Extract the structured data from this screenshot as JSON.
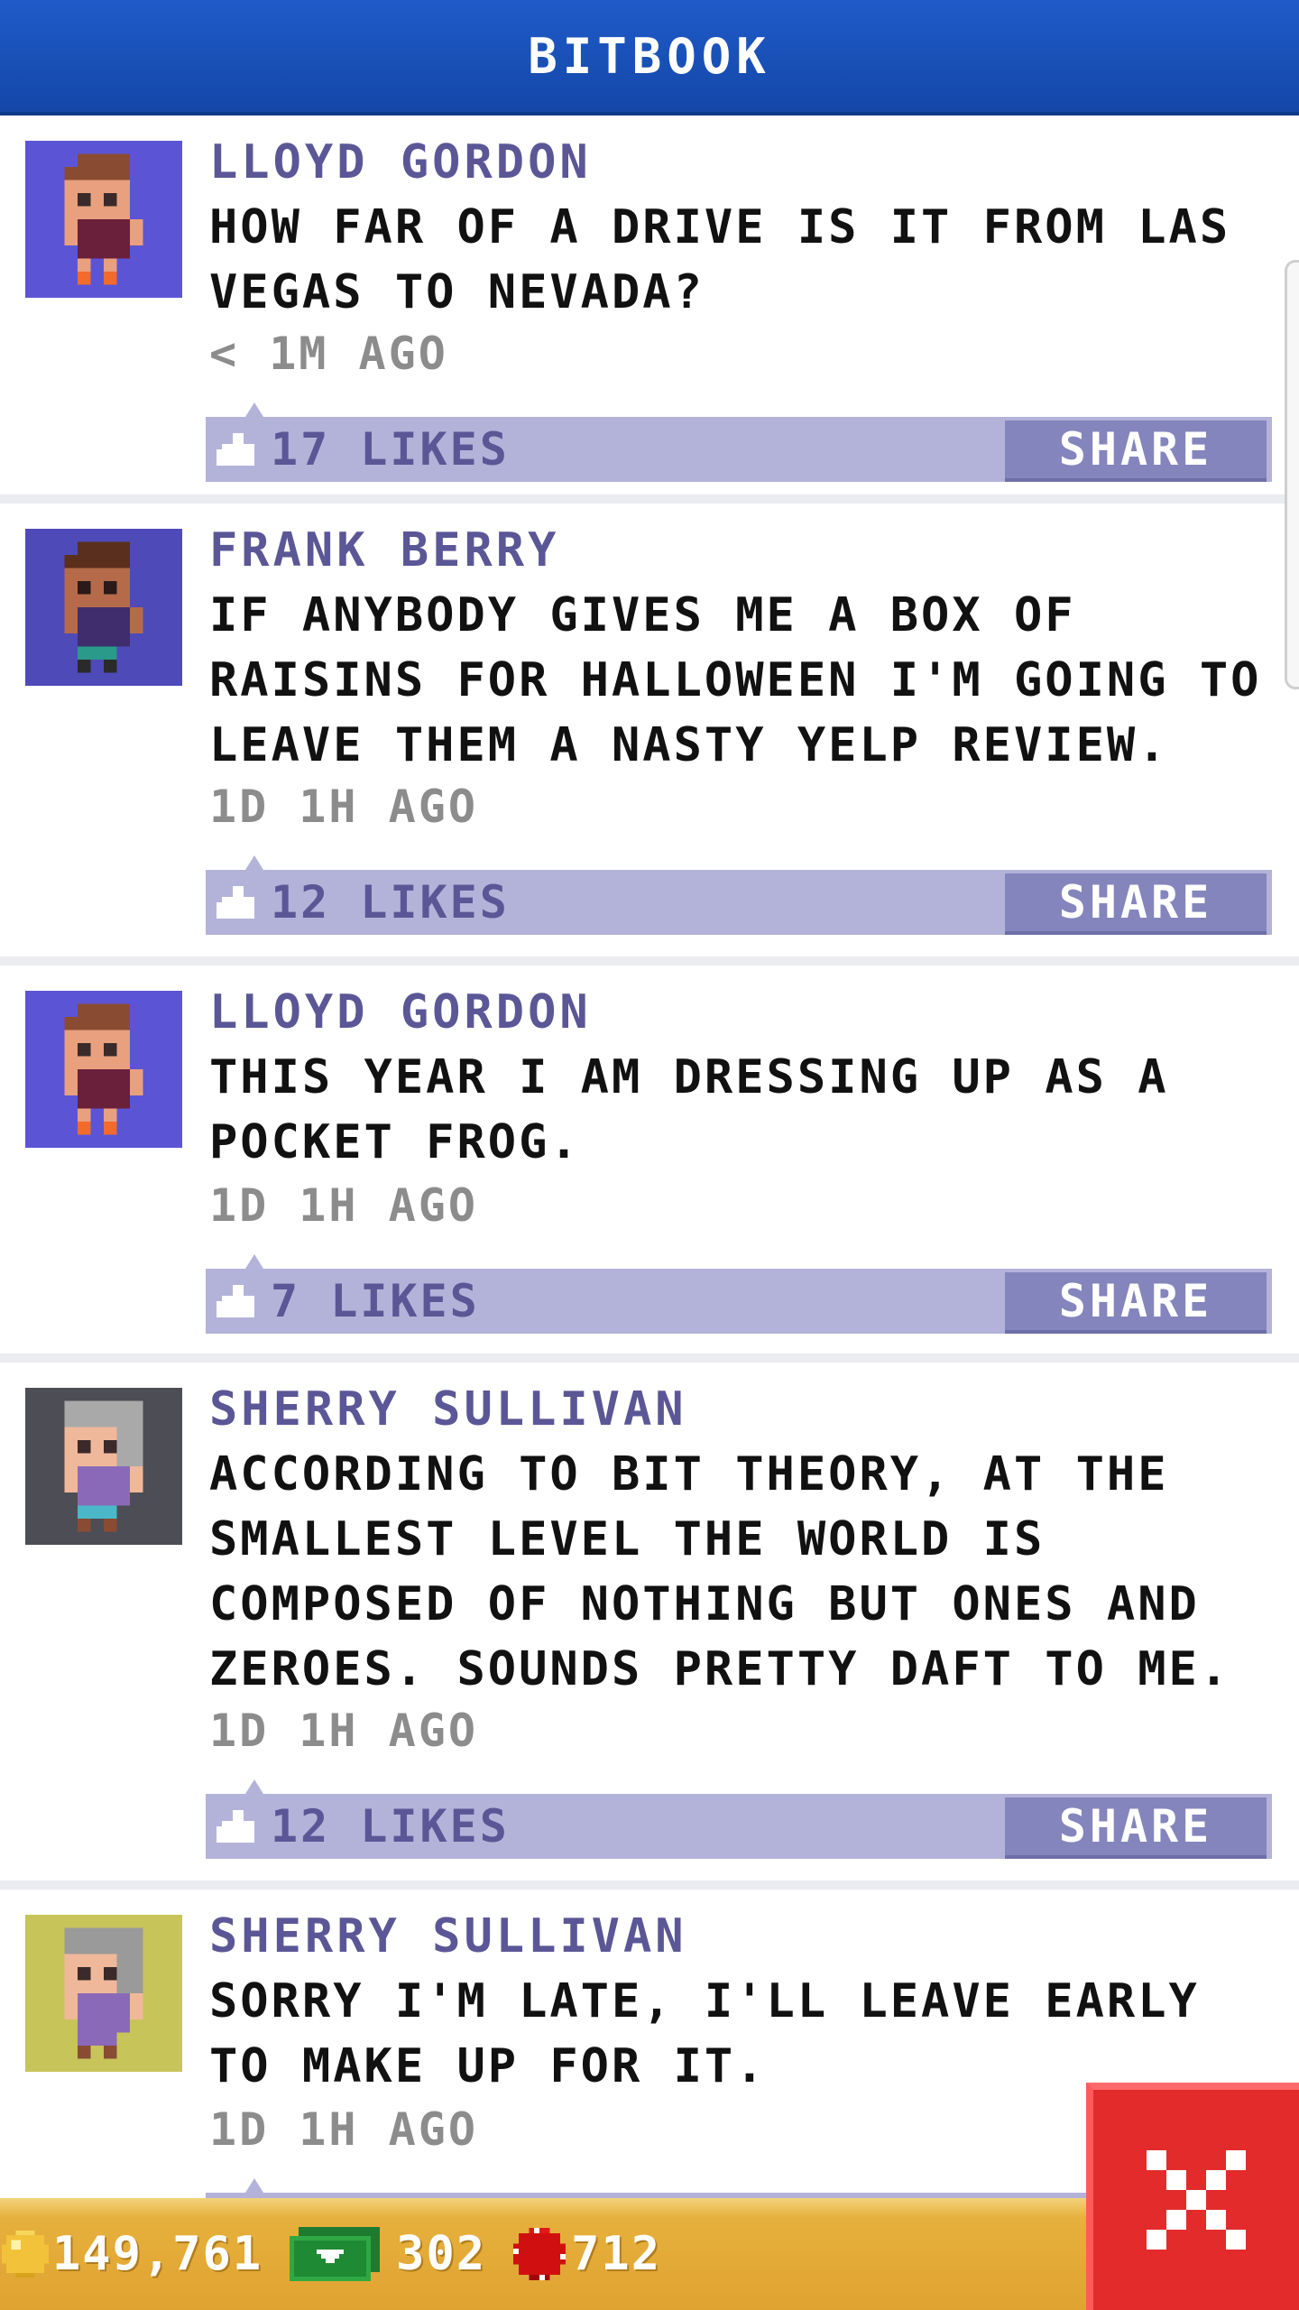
{
  "header": {
    "title": "BITBOOK"
  },
  "posts": [
    {
      "author": "LLOYD GORDON",
      "text": "HOW FAR OF A DRIVE IS IT FROM LAS VEGAS TO NEVADA?",
      "time": "< 1M AGO",
      "likes": "17 LIKES",
      "share": "SHARE",
      "avatar_bg": "#5b55d6"
    },
    {
      "author": "FRANK BERRY",
      "text": "IF ANYBODY GIVES ME A BOX OF RAISINS FOR HALLOWEEN I'M GOING TO LEAVE THEM A NASTY YELP REVIEW.",
      "time": "1D 1H AGO",
      "likes": "12 LIKES",
      "share": "SHARE",
      "avatar_bg": "#4e4ab8"
    },
    {
      "author": "LLOYD GORDON",
      "text": "THIS YEAR I AM DRESSING UP AS A POCKET FROG.",
      "time": "1D 1H AGO",
      "likes": "7 LIKES",
      "share": "SHARE",
      "avatar_bg": "#5b55d6"
    },
    {
      "author": "SHERRY SULLIVAN",
      "text": "ACCORDING TO BIT THEORY, AT THE SMALLEST LEVEL THE WORLD IS COMPOSED OF NOTHING BUT ONES AND ZEROES. SOUNDS PRETTY DAFT TO ME.",
      "time": "1D 1H AGO",
      "likes": "12 LIKES",
      "share": "SHARE",
      "avatar_bg": "#4d4d55"
    },
    {
      "author": "SHERRY SULLIVAN",
      "text": "SORRY I'M LATE, I'LL LEAVE EARLY TO MAKE UP FOR IT.",
      "time": "1D 1H AGO",
      "likes": "",
      "share": "",
      "avatar_bg": "#c7c45a"
    }
  ],
  "footer": {
    "coins": "149,761",
    "bux": "302",
    "gems": "712"
  },
  "icons": {
    "thumb": "thumbs-up-icon",
    "coin": "coin-icon",
    "cash": "cash-icon",
    "gem": "gem-icon",
    "close": "close-icon"
  }
}
